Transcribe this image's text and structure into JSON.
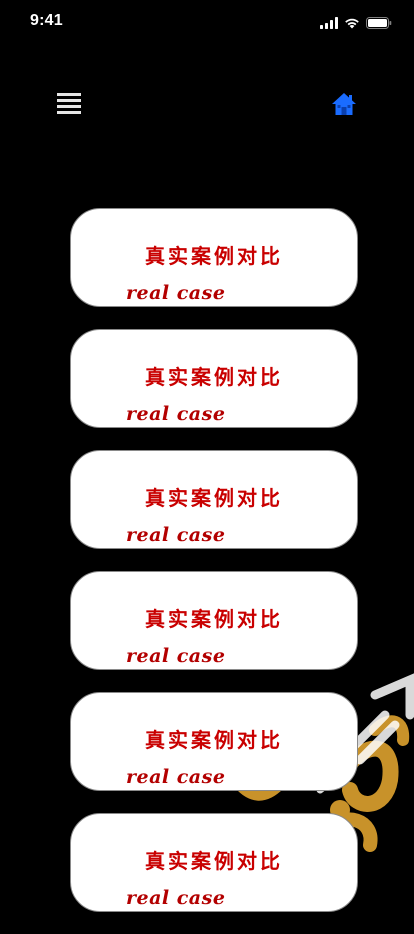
{
  "status_bar": {
    "time": "9:41",
    "icons": [
      "signal-bars-icon",
      "wifi-icon",
      "battery-icon"
    ]
  },
  "nav": {
    "menu_icon": "menu-list-icon",
    "home_icon": "home-icon",
    "home_color": "#1a6cff"
  },
  "cases": [
    {
      "title": "真实案例对比",
      "subtitle": "real case"
    },
    {
      "title": "真实案例对比",
      "subtitle": "real case"
    },
    {
      "title": "真实案例对比",
      "subtitle": "real case"
    },
    {
      "title": "真实案例对比",
      "subtitle": "real case"
    },
    {
      "title": "真实案例对比",
      "subtitle": "real case"
    },
    {
      "title": "真实案例对比",
      "subtitle": "real case"
    }
  ],
  "colors": {
    "background": "#000000",
    "card": "#ffffff",
    "title_text": "#c90000",
    "watermark": "#c8922a"
  }
}
